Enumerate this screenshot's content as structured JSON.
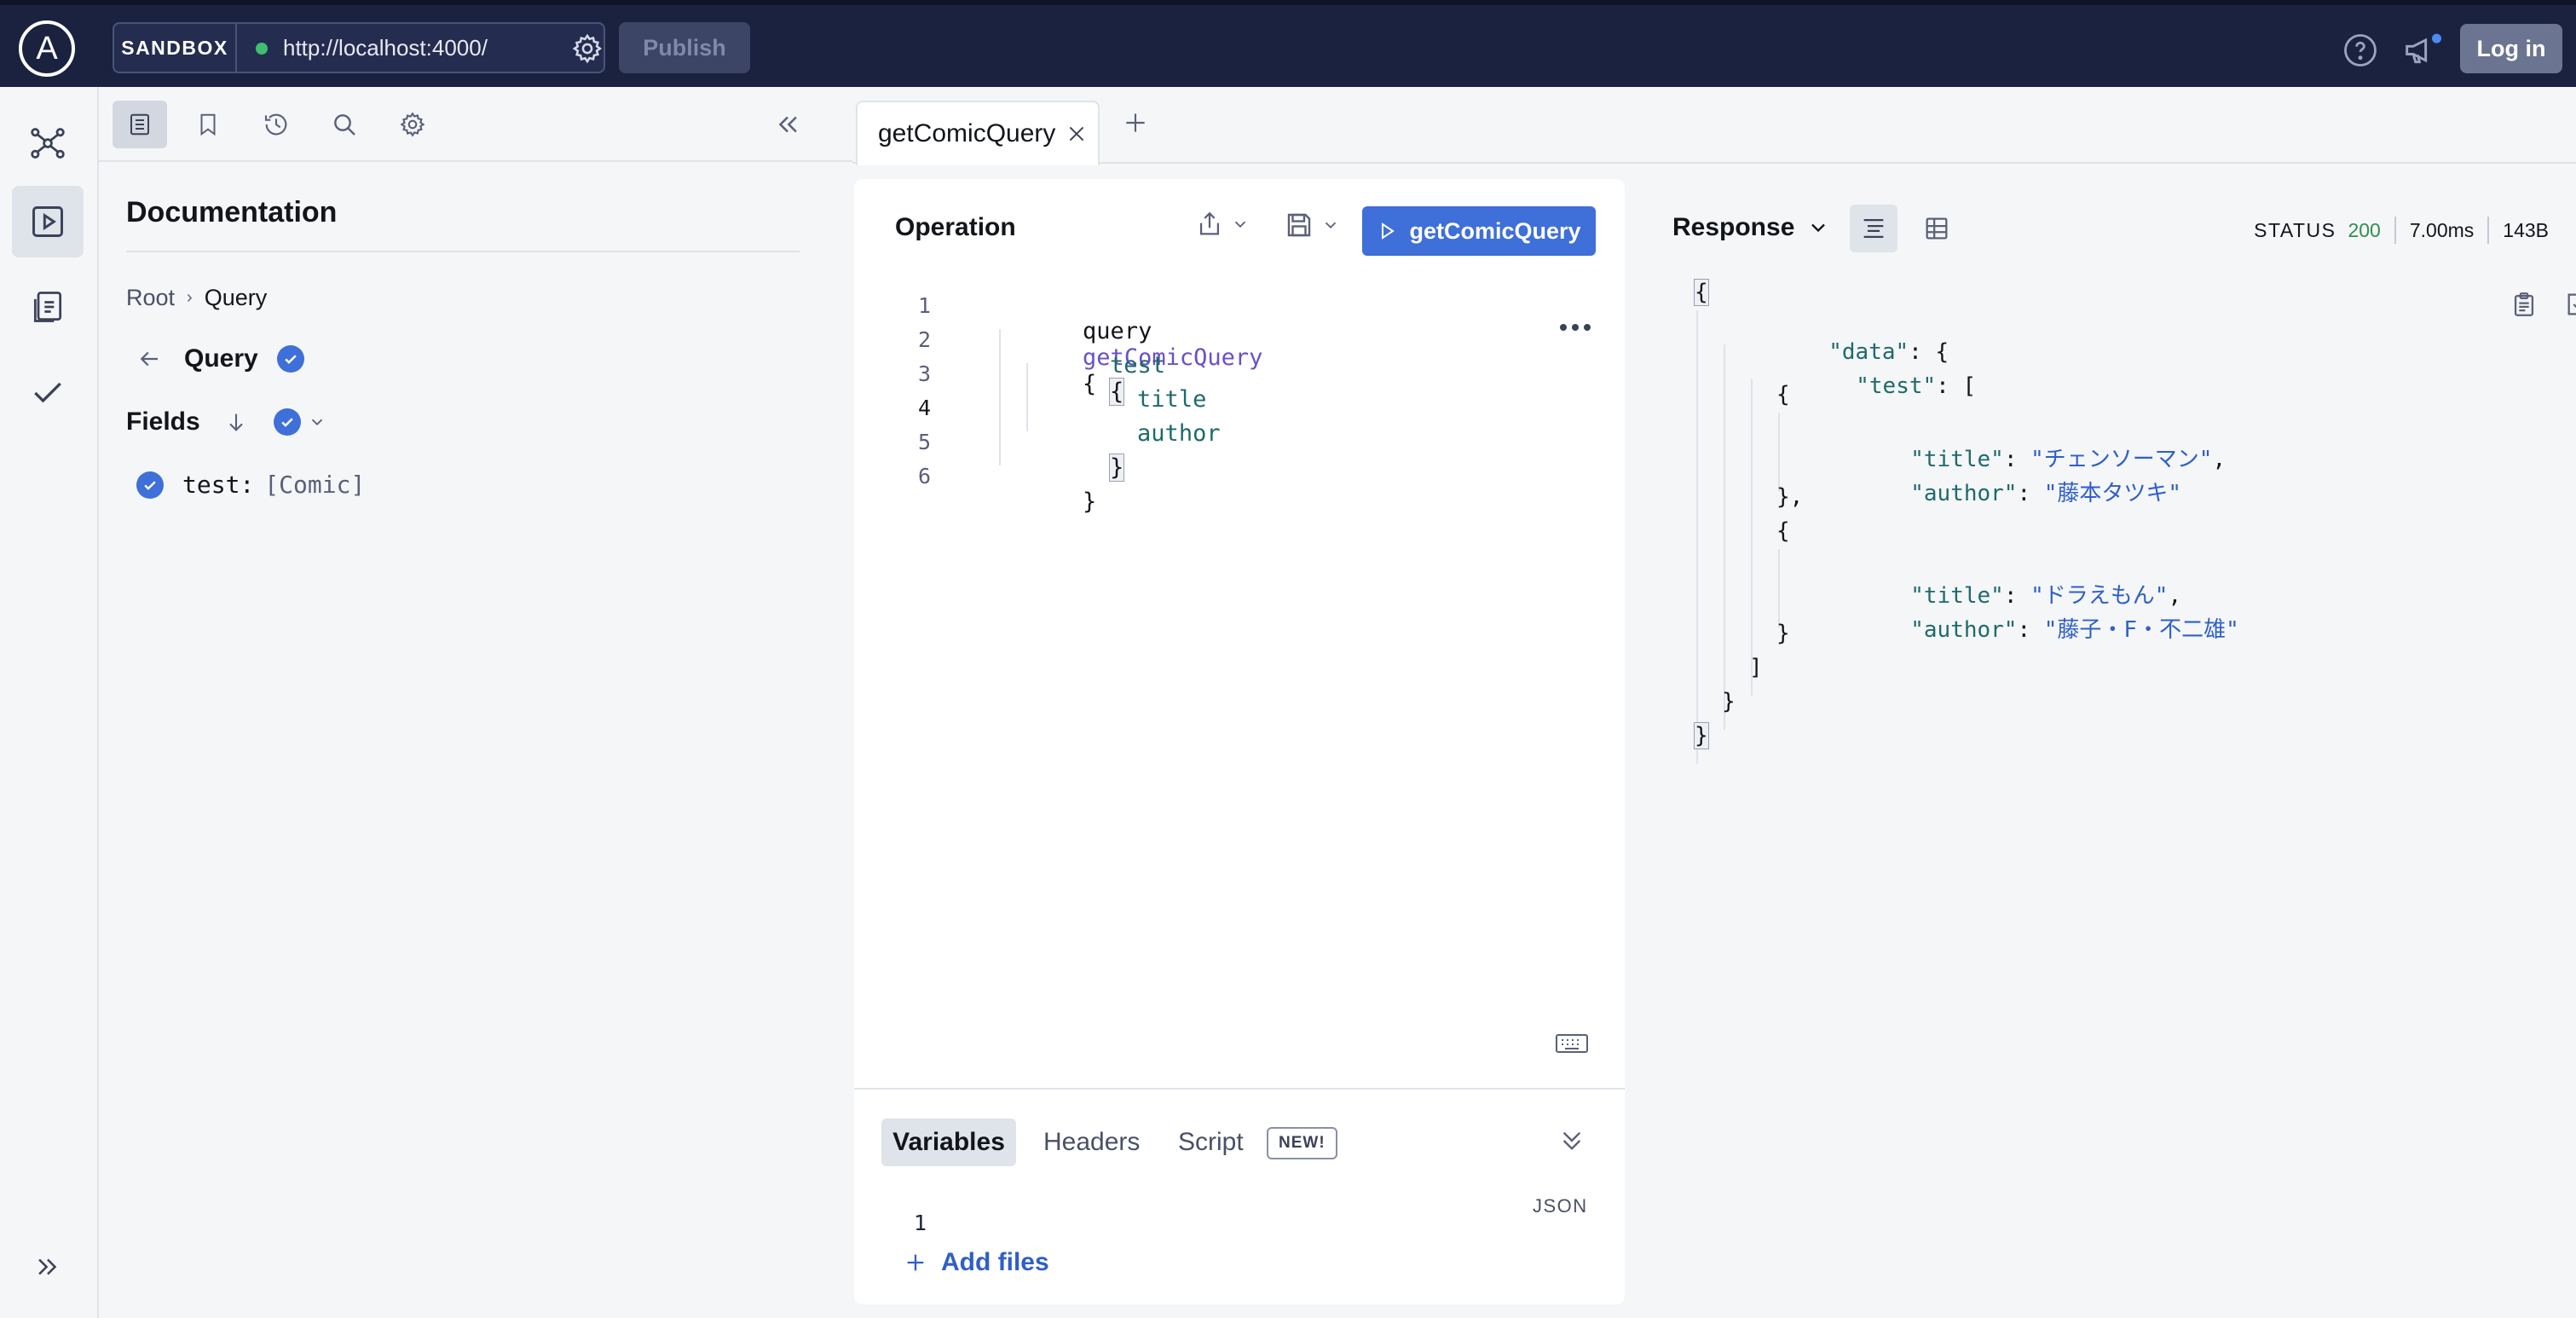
{
  "topbar": {
    "logo": "A",
    "sandbox_label": "SANDBOX",
    "endpoint_url": "http://localhost:4000/",
    "publish_label": "Publish",
    "login_label": "Log in"
  },
  "rail": {
    "items": [
      "schema-graph-icon",
      "explorer-play-icon",
      "operation-collections-icon",
      "checks-icon"
    ],
    "expand_icon": "double-chevron-right-icon"
  },
  "docs": {
    "toolbar_icons": [
      "documentation-icon",
      "bookmark-icon",
      "history-icon",
      "search-icon",
      "settings-icon"
    ],
    "collapse_icon": "double-chevron-left-icon",
    "title": "Documentation",
    "breadcrumb": {
      "root": "Root",
      "current": "Query"
    },
    "query_title": "Query",
    "fields_label": "Fields",
    "field": {
      "name": "test:",
      "type": "[Comic]"
    }
  },
  "tabs": {
    "active_label": "getComicQuery"
  },
  "operation": {
    "title": "Operation",
    "run_label": "getComicQuery",
    "line_numbers": [
      "1",
      "2",
      "3",
      "4",
      "5",
      "6"
    ],
    "code": {
      "l1_kw": "query",
      "l1_name": "getComicQuery",
      "l1_brace": "{",
      "l2_field": "test",
      "l2_brace": "{",
      "l3_field": "title",
      "l4_field": "author",
      "l5_brace": "}",
      "l6_brace": "}"
    },
    "bottom_tabs": {
      "variables": "Variables",
      "headers": "Headers",
      "script": "Script",
      "new_badge": "NEW!"
    },
    "json_label": "JSON",
    "vars_line_number": "1",
    "add_files_label": "Add files"
  },
  "response": {
    "title": "Response",
    "status_label": "STATUS",
    "status_code": "200",
    "time": "7.00ms",
    "size": "143B",
    "lines": {
      "open": "{",
      "data_key": "\"data\"",
      "test_key": "\"test\"",
      "obj_open": "{",
      "title_key": "\"title\"",
      "author_key": "\"author\"",
      "title_1": "\"チェンソーマン\"",
      "author_1": "\"藤本タツキ\"",
      "obj_close_comma": "},",
      "title_2": "\"ドラえもん\"",
      "author_2": "\"藤子・F・不二雄\"",
      "obj_close": "}",
      "arr_close": "]",
      "data_close": "}",
      "close": "}"
    }
  },
  "colors": {
    "topbar": "#1b2240",
    "accent": "#3f6fd8",
    "status_ok": "#2f8f4a"
  }
}
